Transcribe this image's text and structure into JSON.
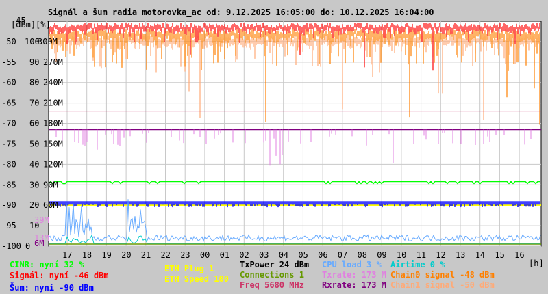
{
  "chart_data": {
    "type": "line",
    "title": "Signál a šum radia motorovka_ac od: 9.12.2025 16:05:00 do: 10.12.2025 16:04:00",
    "ylabel_units": [
      "[dBm]",
      "[%]"
    ],
    "xunit": "[h]",
    "ylim": [
      -100,
      -45
    ],
    "yticks": [
      {
        "dbm": "-45",
        "pct": "",
        "rate": ""
      },
      {
        "dbm": "-50",
        "pct": "100",
        "rate": "300M"
      },
      {
        "dbm": "-55",
        "pct": "90",
        "rate": "270M"
      },
      {
        "dbm": "-60",
        "pct": "80",
        "rate": "240M"
      },
      {
        "dbm": "-65",
        "pct": "70",
        "rate": "210M"
      },
      {
        "dbm": "-70",
        "pct": "60",
        "rate": "180M"
      },
      {
        "dbm": "-75",
        "pct": "50",
        "rate": "150M"
      },
      {
        "dbm": "-80",
        "pct": "40",
        "rate": "120M"
      },
      {
        "dbm": "-85",
        "pct": "30",
        "rate": "90M"
      },
      {
        "dbm": "-90",
        "pct": "20",
        "rate": "60M"
      },
      {
        "dbm": "-95",
        "pct": "10",
        "rate": ""
      },
      {
        "dbm": "-100",
        "pct": "0",
        "rate": ""
      }
    ],
    "extra_labels": [
      "39M",
      "13M",
      "6M"
    ],
    "xticks": [
      "17",
      "18",
      "19",
      "20",
      "21",
      "22",
      "23",
      "00",
      "01",
      "02",
      "03",
      "04",
      "05",
      "06",
      "07",
      "08",
      "09",
      "10",
      "11",
      "12",
      "13",
      "14",
      "15",
      "16"
    ],
    "series": [
      {
        "name": "Signál",
        "color": "#ff0000",
        "level": -47
      },
      {
        "name": "Chain0 signal",
        "color": "#ff8000",
        "level": -48.5
      },
      {
        "name": "Chain1 signal",
        "color": "#ffaa77",
        "level": -50
      },
      {
        "name": "Freq",
        "color": "#cc3366",
        "level": -67
      },
      {
        "name": "Rxrate",
        "color": "#800080",
        "level": -71.5
      },
      {
        "name": "Txrate",
        "color": "#e080e0",
        "level": -71.5
      },
      {
        "name": "CINR",
        "color": "#00ff00",
        "level": -84.2
      },
      {
        "name": "Šum",
        "color": "#0000ff",
        "level": -89.5
      },
      {
        "name": "ETH Speed",
        "color": "#ffff00",
        "level": -90
      },
      {
        "name": "CPU load",
        "color": "#66aaff",
        "level": -98
      },
      {
        "name": "Airtime",
        "color": "#00cccc",
        "level": -99
      },
      {
        "name": "Connections",
        "color": "#669900",
        "level": -99.5
      }
    ]
  },
  "legend": {
    "cinr": "CINR: nyní 32 %",
    "signal": "Signál: nyní -46 dBm",
    "noise": "Šum: nyní -90 dBm",
    "eth_plug": "ETH Plug 1",
    "eth_speed": "ETH Speed 100",
    "txpower": "TxPower 24 dBm",
    "connections": "Connections 1",
    "freq": "Freq 5680 MHz",
    "cpu": "CPU load 3 %",
    "txrate": "Txrate: 173 M",
    "rxrate": "Rxrate: 173 M",
    "airtime": "Airtime 0 %",
    "chain0": "Chain0 signal -48 dBm",
    "chain1": "Chain1 signal -50 dBm"
  }
}
